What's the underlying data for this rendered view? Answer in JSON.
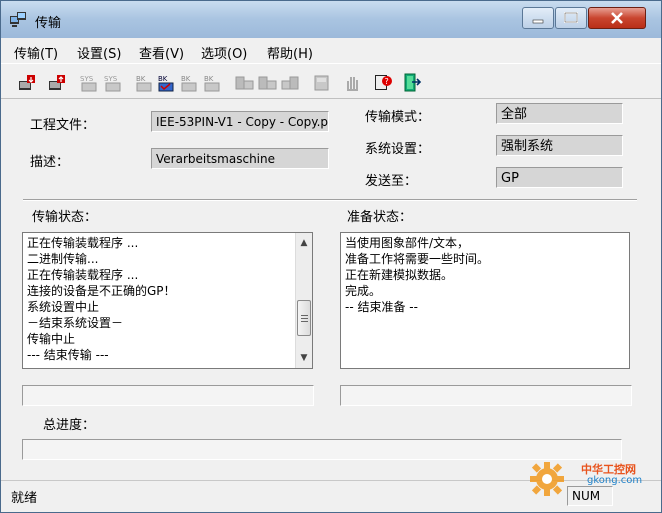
{
  "window": {
    "title": "传输"
  },
  "menu": [
    {
      "label": "传输(T)"
    },
    {
      "label": "设置(S)"
    },
    {
      "label": "查看(V)"
    },
    {
      "label": "选项(O)"
    },
    {
      "label": "帮助(H)"
    }
  ],
  "toolbar": {
    "icons": [
      {
        "name": "transfer-download-icon"
      },
      {
        "name": "transfer-upload-icon"
      },
      {
        "name": "sys-download-icon",
        "text": "SYS"
      },
      {
        "name": "sys-upload-icon",
        "text": "SYS"
      },
      {
        "name": "backup-download-icon",
        "text": "BK"
      },
      {
        "name": "backup-verify-icon",
        "text": "BK"
      },
      {
        "name": "backup-upload-icon",
        "text": "BK"
      },
      {
        "name": "backup-restore-icon",
        "text": "BK"
      },
      {
        "name": "recipe-download-icon"
      },
      {
        "name": "recipe-upload-icon"
      },
      {
        "name": "recipe-compare-icon"
      },
      {
        "name": "device-icon"
      },
      {
        "name": "hand-icon"
      },
      {
        "name": "help-icon"
      },
      {
        "name": "exit-icon"
      }
    ]
  },
  "form": {
    "project_label": "工程文件：",
    "project_value": "IEE-53PIN-V1 - Copy - Copy.p",
    "desc_label": "描述：",
    "desc_value": "Verarbeitsmaschine",
    "mode_label": "传输模式：",
    "mode_value": "全部",
    "sys_label": "系统设置：",
    "sys_value": "强制系统",
    "send_label": "发送至：",
    "send_value": "GP"
  },
  "transfer_status": {
    "label": "传输状态：",
    "lines": [
      "正在传输装载程序 ...",
      "二进制传输...",
      "正在传输装载程序 ...",
      "连接的设备是不正确的GP！",
      "系统设置中止",
      "－结束系统设置－",
      "传输中止",
      "--- 结束传输 ---"
    ]
  },
  "prep_status": {
    "label": "准备状态：",
    "lines": [
      "当使用图象部件/文本，",
      "准备工作将需要一些时间。",
      "正在新建模拟数据。",
      "完成。",
      "-- 结束准备 --"
    ]
  },
  "progress": {
    "total_label": "总进度："
  },
  "statusbar": {
    "text": "就绪",
    "num": "NUM"
  },
  "watermark": {
    "name": "中华工控网",
    "domain": "gkong.com"
  },
  "colors": {
    "field_bg": "#d6d6d6",
    "close_btn": "#c9452f",
    "titlebar": "#a9c4e1"
  }
}
